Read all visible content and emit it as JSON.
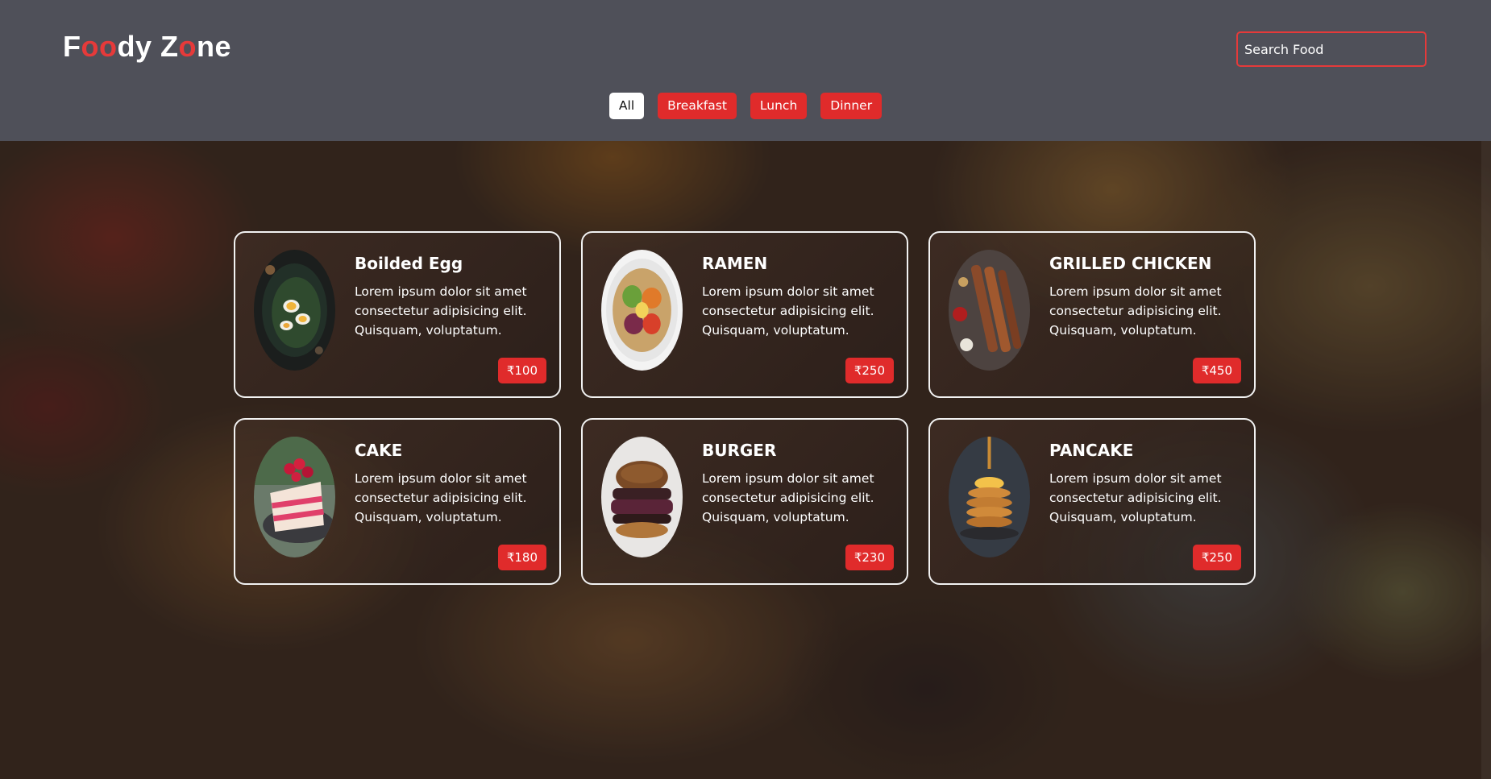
{
  "header": {
    "logo": {
      "part1": "F",
      "part2": "oo",
      "part3": "dy Z",
      "part4": "o",
      "part5": "ne"
    },
    "search": {
      "placeholder": "Search Food",
      "value": ""
    }
  },
  "filters": [
    {
      "label": "All",
      "active": true
    },
    {
      "label": "Breakfast",
      "active": false
    },
    {
      "label": "Lunch",
      "active": false
    },
    {
      "label": "Dinner",
      "active": false
    }
  ],
  "foods": [
    {
      "name": "Boilded Egg",
      "text": "Lorem ipsum dolor sit amet consectetur adipisicing elit. Quisquam, voluptatum.",
      "price": "₹100"
    },
    {
      "name": "RAMEN",
      "text": "Lorem ipsum dolor sit amet consectetur adipisicing elit. Quisquam, voluptatum.",
      "price": "₹250"
    },
    {
      "name": "GRILLED CHICKEN",
      "text": "Lorem ipsum dolor sit amet consectetur adipisicing elit. Quisquam, voluptatum.",
      "price": "₹450"
    },
    {
      "name": "CAKE",
      "text": "Lorem ipsum dolor sit amet consectetur adipisicing elit. Quisquam, voluptatum.",
      "price": "₹180"
    },
    {
      "name": "BURGER",
      "text": "Lorem ipsum dolor sit amet consectetur adipisicing elit. Quisquam, voluptatum.",
      "price": "₹230"
    },
    {
      "name": "PANCAKE",
      "text": "Lorem ipsum dolor sit amet consectetur adipisicing elit. Quisquam, voluptatum.",
      "price": "₹250"
    }
  ],
  "colors": {
    "accent": "#e02b2b",
    "header_bg": "#4f5059",
    "text": "#ffffff"
  }
}
